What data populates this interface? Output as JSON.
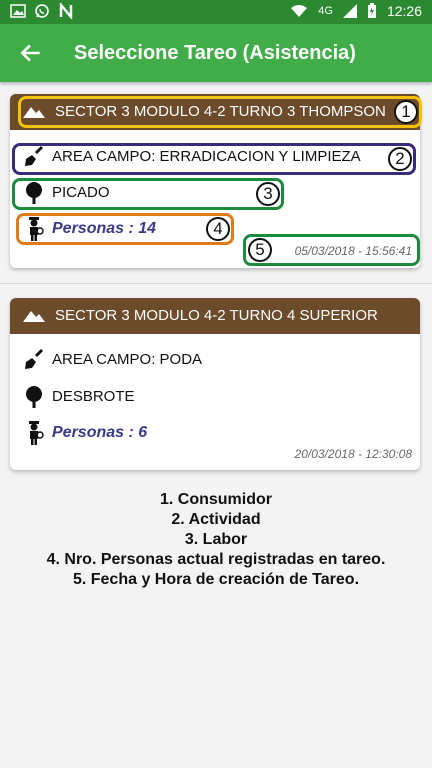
{
  "status_bar": {
    "time": "12:26",
    "network": "4G",
    "icons": [
      "image-icon",
      "whatsapp-icon",
      "n-icon",
      "wifi-icon",
      "signal-icon",
      "battery-icon"
    ]
  },
  "app_bar": {
    "title": "Seleccione Tareo (Asistencia)",
    "back_icon": "arrow-back-icon"
  },
  "cards": [
    {
      "header": "SECTOR 3 MODULO 4-2 TURNO 3 THOMPSON",
      "area": "AREA CAMPO: ERRADICACION Y LIMPIEZA",
      "labor": "PICADO",
      "persons": "Personas : 14",
      "datetime": "05/03/2018 - 15:56:41"
    },
    {
      "header": "SECTOR 3 MODULO 4-2 TURNO 4 SUPERIOR",
      "area": "AREA CAMPO: PODA",
      "labor": "DESBROTE",
      "persons": "Personas : 6",
      "datetime": "20/03/2018 - 12:30:08"
    }
  ],
  "annotations": {
    "markers": [
      "1",
      "2",
      "3",
      "4",
      "5"
    ],
    "colors": {
      "yellow": "#f2c200",
      "purple": "#3b2a7a",
      "green": "#1e8a3c",
      "orange": "#e07b1a"
    }
  },
  "legend": [
    "1. Consumidor",
    "2. Actividad",
    "3. Labor",
    "4. Nro. Personas actual registradas en tareo.",
    "5. Fecha y Hora de creación de Tareo."
  ]
}
